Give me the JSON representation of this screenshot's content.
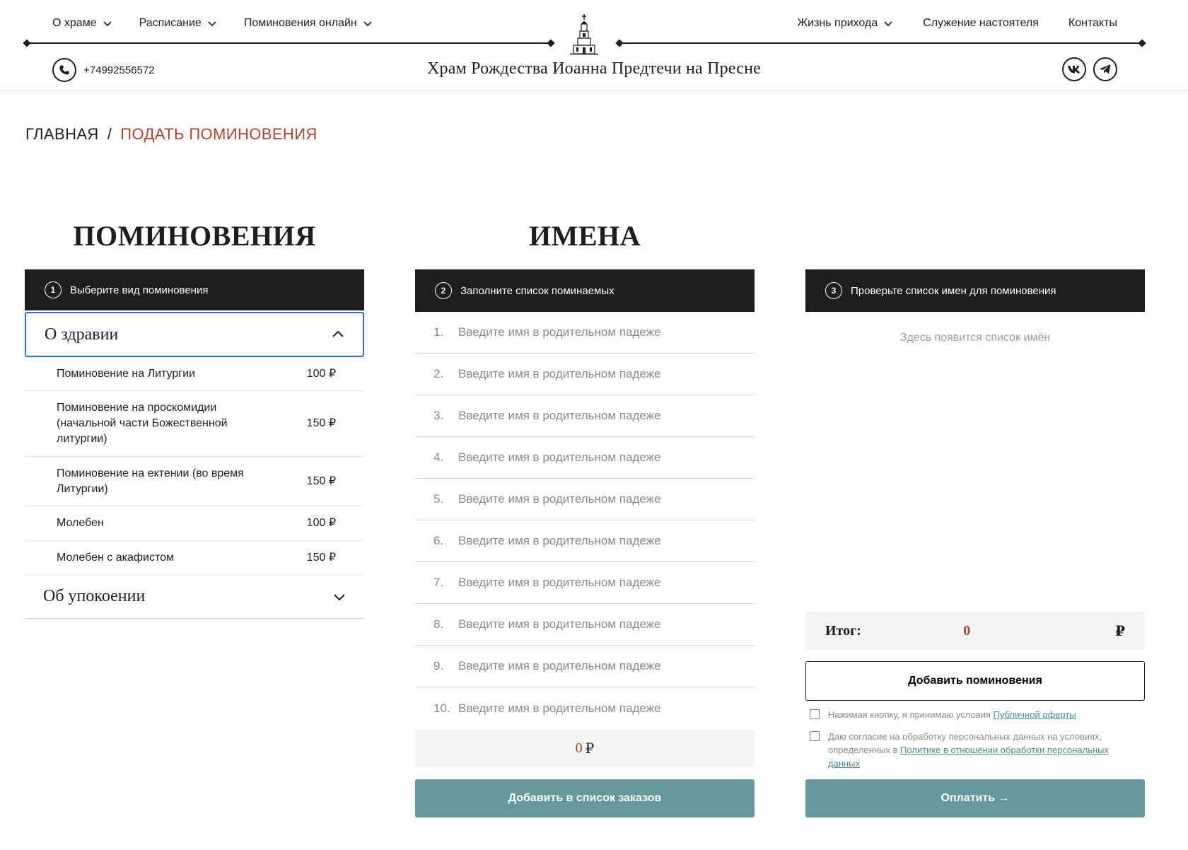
{
  "nav": {
    "left": [
      {
        "label": "О храме"
      },
      {
        "label": "Расписание"
      },
      {
        "label": "Поминовения онлайн"
      }
    ],
    "right": [
      {
        "label": "Жизнь прихода",
        "dropdown": true
      },
      {
        "label": "Служение настоятеля",
        "dropdown": false
      },
      {
        "label": "Контакты",
        "dropdown": false
      }
    ]
  },
  "header": {
    "phone": "+74992556572",
    "site_title": "Храм Рождества Иоанна Предтечи на Пресне",
    "icons": [
      "phone-icon",
      "vk-icon",
      "telegram-icon",
      "church-logo"
    ]
  },
  "breadcrumb": {
    "home": "ГЛАВНАЯ",
    "separator": "/",
    "current": "ПОДАТЬ ПОМИНОВЕНИЯ"
  },
  "headings": {
    "left": "ПОМИНОВЕНИЯ",
    "middle": "ИМЕНА"
  },
  "steps": [
    {
      "num": "1",
      "label": "Выберите вид поминовения"
    },
    {
      "num": "2",
      "label": "Заполните список поминаемых"
    },
    {
      "num": "3",
      "label": "Проверьте список имен для поминовения"
    }
  ],
  "services": {
    "open_group": "О здравии",
    "items": [
      {
        "name": "Поминовение на Литургии",
        "price": "100 ₽"
      },
      {
        "name": "Поминовение на проскомидии (начальной части Божественной литургии)",
        "price": "150 ₽"
      },
      {
        "name": "Поминовение на ектении (во время Литургии)",
        "price": "150 ₽"
      },
      {
        "name": "Молебен",
        "price": "100 ₽"
      },
      {
        "name": "Молебен с акафистом",
        "price": "150 ₽"
      }
    ],
    "closed_group": "Об упокоении"
  },
  "names": {
    "placeholder": "Введите имя в родительном падеже",
    "rows": [
      "1.",
      "2.",
      "3.",
      "4.",
      "5.",
      "6.",
      "7.",
      "8.",
      "9.",
      "10."
    ],
    "sum_value": "0",
    "currency": "₽",
    "add_button": "Добавить в список заказов"
  },
  "summary": {
    "empty_note": "Здесь появится список имён",
    "total_label": "Итог:",
    "total_value": "0",
    "currency": "₽",
    "add_button": "Добавить поминовения",
    "consent1_text": "Нажимая кнопку, я принимаю условия ",
    "consent1_link": "Публичной оферты",
    "consent2_text": "Даю согласие на обработку персональных данных на условиях, определенных в ",
    "consent2_link": "Политике в отношении обработки персональных данных",
    "pay_button": "Оплатить →"
  },
  "colors": {
    "accent_red": "#a64431",
    "teal": "#65999b",
    "dark": "#1e1e1e",
    "focus_blue": "#2f6fd1"
  }
}
